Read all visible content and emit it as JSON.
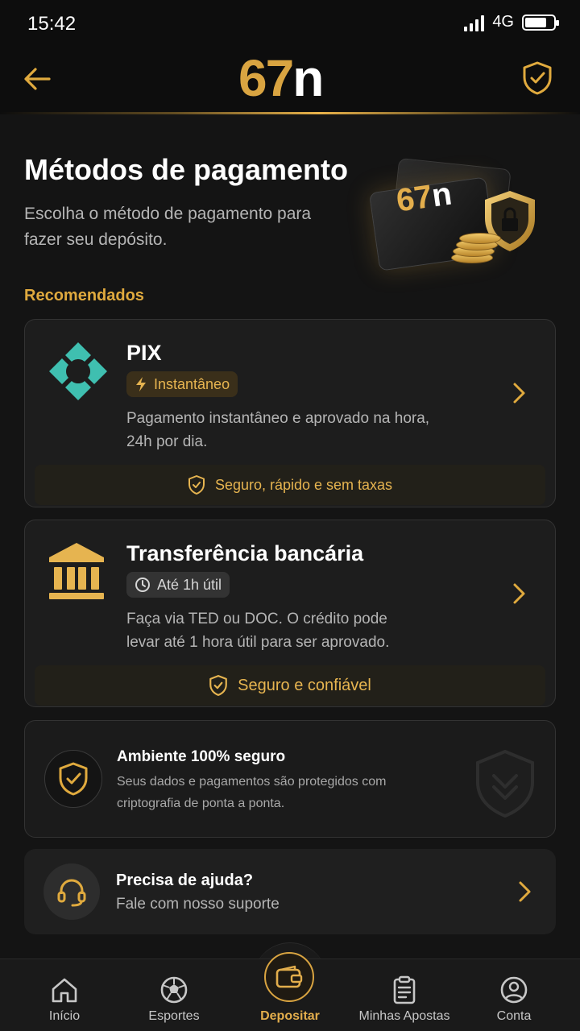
{
  "status_bar": {
    "time": "15:42",
    "network": "4G",
    "battery_level": 0.76
  },
  "header": {
    "logo_num": "67",
    "logo_letter": "n",
    "back_icon": "arrow-left-icon",
    "shield_icon": "shield-check-icon"
  },
  "hero": {
    "title": "Métodos de pagamento",
    "subtitle": "Escolha o método de pagamento para fazer seu depósito.",
    "art_logo_num": "67",
    "art_logo_letter": "n"
  },
  "section_label": "Recomendados",
  "methods": [
    {
      "title": "PIX",
      "badge": "Instantâneo",
      "badge_icon": "lightning-icon",
      "description": "Pagamento instantâneo e aprovado na hora, 24h por dia.",
      "footer": "Seguro, rápido e sem taxas",
      "icon": "pix-icon"
    },
    {
      "title": "Transferência bancária",
      "badge": "Até 1h útil",
      "badge_icon": "clock-icon",
      "description": "Faça via TED ou DOC. O crédito pode levar até 1 hora útil para ser aprovado.",
      "footer": "Seguro e confiável",
      "icon": "bank-icon"
    }
  ],
  "secure": {
    "title": "Ambiente 100% seguro",
    "description": "Seus dados e pagamentos são protegidos com criptografia de ponta a ponta."
  },
  "help": {
    "title": "Precisa de ajuda?",
    "subtitle": "Fale com nosso suporte"
  },
  "nav": [
    {
      "label": "Início",
      "icon": "home-icon"
    },
    {
      "label": "Esportes",
      "icon": "soccer-ball-icon"
    },
    {
      "label": "Depositar",
      "icon": "wallet-icon",
      "active": true
    },
    {
      "label": "Minhas Apostas",
      "icon": "clipboard-icon"
    },
    {
      "label": "Conta",
      "icon": "user-icon"
    }
  ],
  "colors": {
    "gold": "#e0aa3e",
    "pix_teal": "#3fbfb0",
    "background": "#141414",
    "card": "#1d1d1d"
  }
}
